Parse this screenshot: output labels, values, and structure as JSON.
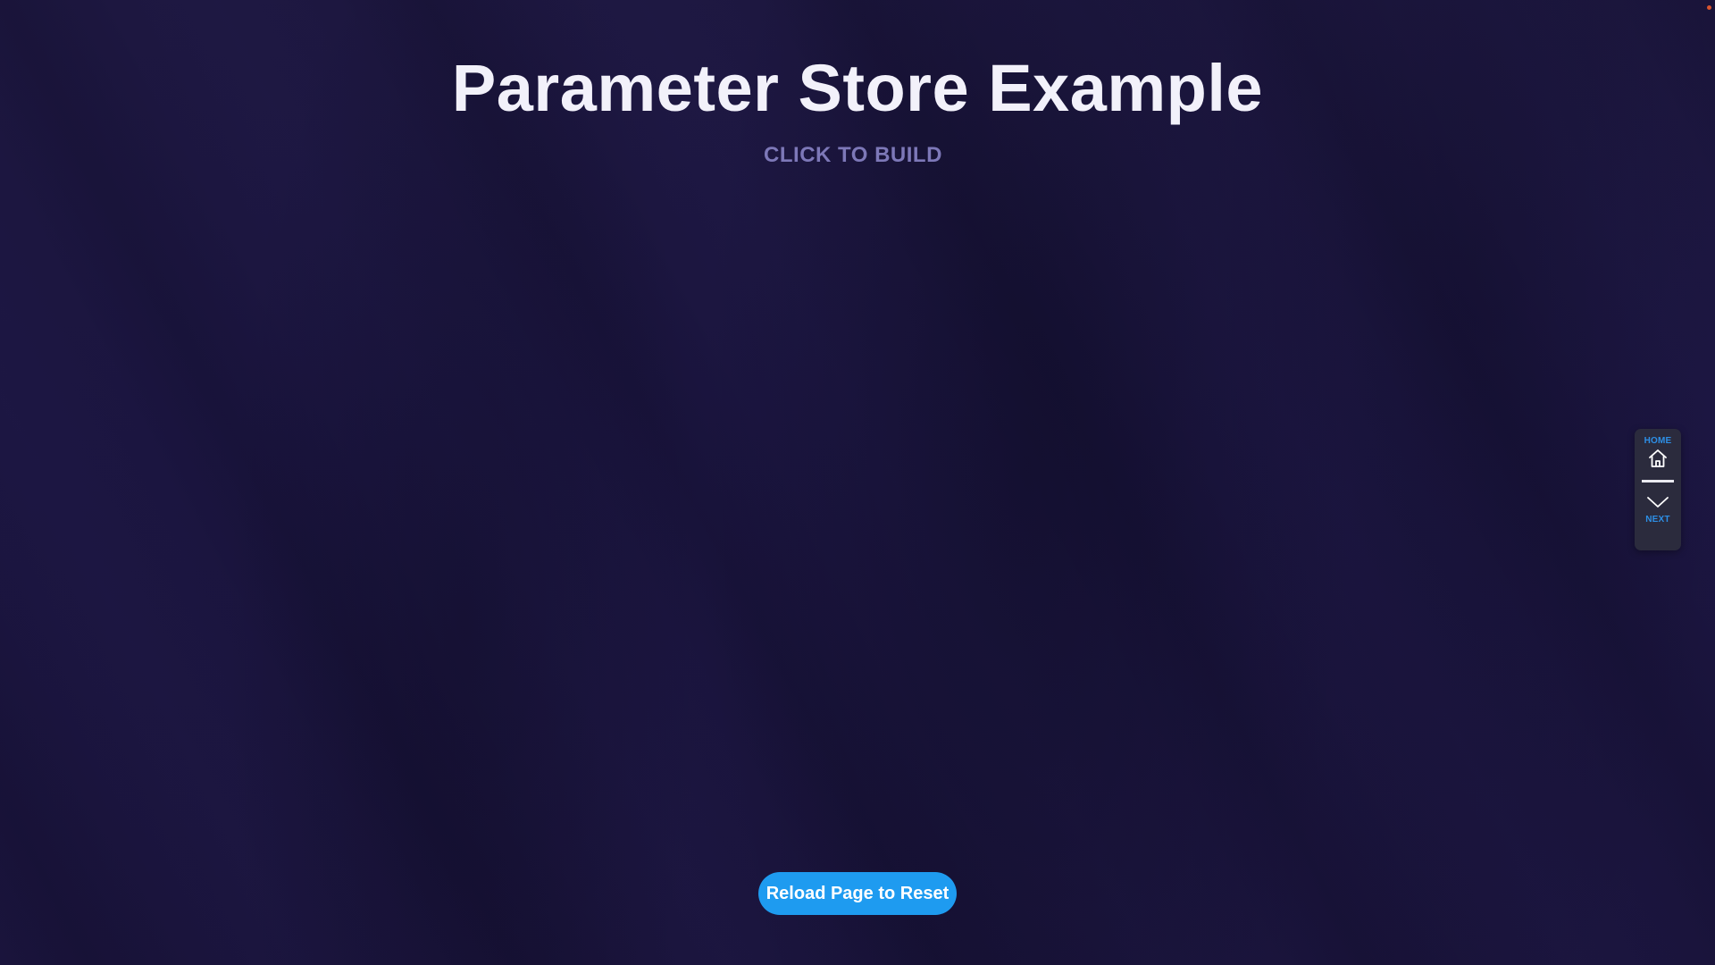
{
  "page": {
    "title": "Parameter Store Example",
    "subtitle": "CLICK TO BUILD"
  },
  "actions": {
    "reset_label": "Reload Page to Reset"
  },
  "nav": {
    "home_label": "HOME",
    "home_icon": "home-icon",
    "next_label": "NEXT",
    "next_icon": "chevron-down-icon"
  },
  "colors": {
    "background": "#1c1640",
    "title": "#f2f1fa",
    "subtitle": "#7d78b8",
    "accent": "#1e9bf0",
    "nav_panel": "#2b2b3d",
    "nav_label": "#2d8fe6",
    "indicator_dot": "#d9542f"
  }
}
